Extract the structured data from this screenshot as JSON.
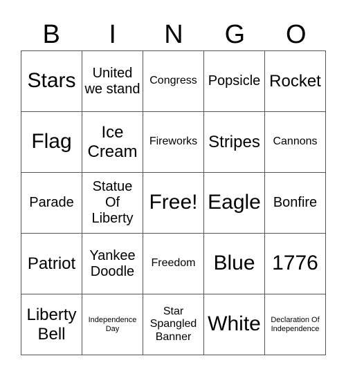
{
  "header": [
    "B",
    "I",
    "N",
    "G",
    "O"
  ],
  "cells": [
    {
      "text": "Stars",
      "size": "s-xl"
    },
    {
      "text": "United we stand",
      "size": "s-m"
    },
    {
      "text": "Congress",
      "size": "s-s"
    },
    {
      "text": "Popsicle",
      "size": "s-m"
    },
    {
      "text": "Rocket",
      "size": "s-l"
    },
    {
      "text": "Flag",
      "size": "s-xl"
    },
    {
      "text": "Ice Cream",
      "size": "s-l"
    },
    {
      "text": "Fireworks",
      "size": "s-s"
    },
    {
      "text": "Stripes",
      "size": "s-l"
    },
    {
      "text": "Cannons",
      "size": "s-s"
    },
    {
      "text": "Parade",
      "size": "s-m"
    },
    {
      "text": "Statue Of Liberty",
      "size": "s-m"
    },
    {
      "text": "Free!",
      "size": "s-xl"
    },
    {
      "text": "Eagle",
      "size": "s-xl"
    },
    {
      "text": "Bonfire",
      "size": "s-m"
    },
    {
      "text": "Patriot",
      "size": "s-l"
    },
    {
      "text": "Yankee Doodle",
      "size": "s-m"
    },
    {
      "text": "Freedom",
      "size": "s-s"
    },
    {
      "text": "Blue",
      "size": "s-xl"
    },
    {
      "text": "1776",
      "size": "s-xl"
    },
    {
      "text": "Liberty Bell",
      "size": "s-l"
    },
    {
      "text": "Independence Day",
      "size": "s-xs"
    },
    {
      "text": "Star Spangled Banner",
      "size": "s-s"
    },
    {
      "text": "White",
      "size": "s-xl"
    },
    {
      "text": "Declaration Of Independence",
      "size": "s-xs"
    }
  ]
}
